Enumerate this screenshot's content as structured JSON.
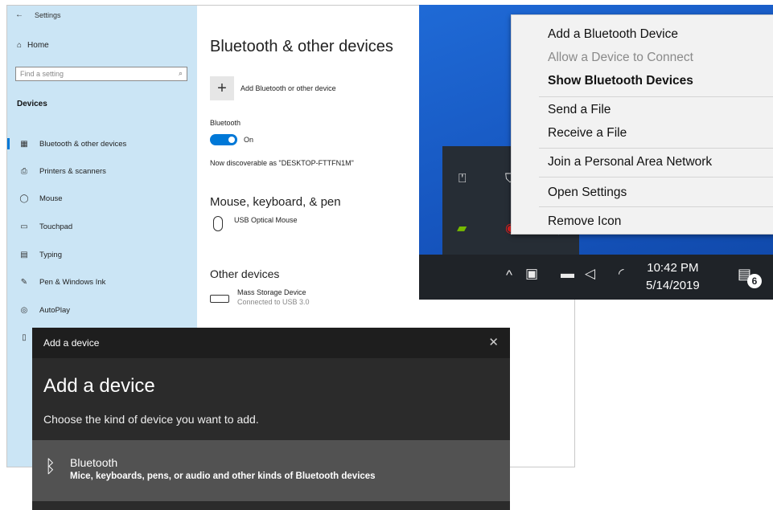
{
  "settings": {
    "window_title": "Settings",
    "home": "Home",
    "search_placeholder": "Find a setting",
    "group": "Devices",
    "nav": [
      {
        "label": "Bluetooth & other devices",
        "icon": "bluetooth-devices-icon",
        "active": true
      },
      {
        "label": "Printers & scanners",
        "icon": "printer-icon"
      },
      {
        "label": "Mouse",
        "icon": "mouse-icon"
      },
      {
        "label": "Touchpad",
        "icon": "touchpad-icon"
      },
      {
        "label": "Typing",
        "icon": "keyboard-icon"
      },
      {
        "label": "Pen & Windows Ink",
        "icon": "pen-icon"
      },
      {
        "label": "AutoPlay",
        "icon": "autoplay-icon"
      }
    ],
    "page_title": "Bluetooth & other devices",
    "add_device": "Add Bluetooth or other device",
    "bluetooth_label": "Bluetooth",
    "bluetooth_state": "On",
    "discoverable": "Now discoverable as \"DESKTOP-FTTFN1M\"",
    "section_mouse": "Mouse, keyboard, & pen",
    "mouse_device": "USB Optical Mouse",
    "section_other": "Other devices",
    "other_device": "Mass Storage Device",
    "other_device_status": "Connected to USB 3.0"
  },
  "context_menu": {
    "items": [
      {
        "label": "Add a Bluetooth Device",
        "style": "normal"
      },
      {
        "label": "Allow a Device to Connect",
        "style": "disabled"
      },
      {
        "label": "Show Bluetooth Devices",
        "style": "bold"
      },
      {
        "label": "Send a File",
        "style": "normal"
      },
      {
        "label": "Receive a File",
        "style": "normal"
      },
      {
        "label": "Join a Personal Area Network",
        "style": "normal"
      },
      {
        "label": "Open Settings",
        "style": "normal"
      },
      {
        "label": "Remove Icon",
        "style": "normal"
      }
    ]
  },
  "taskbar": {
    "time": "10:42 PM",
    "date": "5/14/2019",
    "notification_count": "6"
  },
  "dialog": {
    "window_title": "Add a device",
    "heading": "Add a device",
    "subtitle": "Choose the kind of device you want to add.",
    "option_name": "Bluetooth",
    "option_desc": "Mice, keyboards, pens, or audio and other kinds of Bluetooth devices"
  }
}
